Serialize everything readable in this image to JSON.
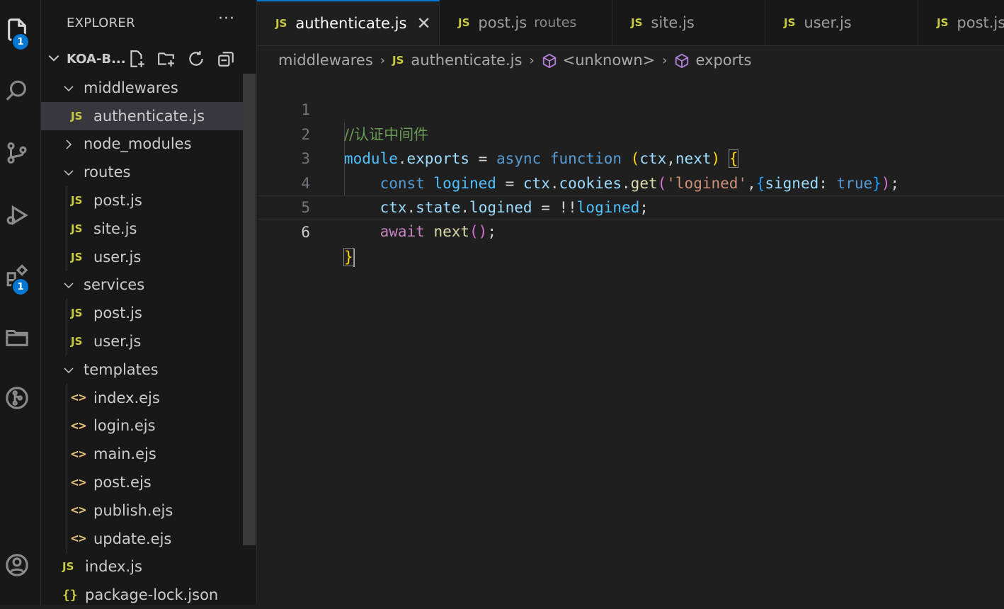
{
  "activity_bar": {
    "explorer_badge": "1",
    "extensions_badge": "1"
  },
  "sidebar": {
    "title": "EXPLORER",
    "more": "···",
    "project": "KOA-B...",
    "tree": [
      {
        "label": "middlewares",
        "kind": "folder",
        "open": true,
        "depth": 1
      },
      {
        "label": "authenticate.js",
        "kind": "js",
        "depth": 2,
        "selected": true
      },
      {
        "label": "node_modules",
        "kind": "folder",
        "open": false,
        "depth": 1
      },
      {
        "label": "routes",
        "kind": "folder",
        "open": true,
        "depth": 1
      },
      {
        "label": "post.js",
        "kind": "js",
        "depth": 2
      },
      {
        "label": "site.js",
        "kind": "js",
        "depth": 2
      },
      {
        "label": "user.js",
        "kind": "js",
        "depth": 2
      },
      {
        "label": "services",
        "kind": "folder",
        "open": true,
        "depth": 1
      },
      {
        "label": "post.js",
        "kind": "js",
        "depth": 2
      },
      {
        "label": "user.js",
        "kind": "js",
        "depth": 2
      },
      {
        "label": "templates",
        "kind": "folder",
        "open": true,
        "depth": 1
      },
      {
        "label": "index.ejs",
        "kind": "ejs",
        "depth": 2
      },
      {
        "label": "login.ejs",
        "kind": "ejs",
        "depth": 2
      },
      {
        "label": "main.ejs",
        "kind": "ejs",
        "depth": 2
      },
      {
        "label": "post.ejs",
        "kind": "ejs",
        "depth": 2
      },
      {
        "label": "publish.ejs",
        "kind": "ejs",
        "depth": 2
      },
      {
        "label": "update.ejs",
        "kind": "ejs",
        "depth": 2
      },
      {
        "label": "index.js",
        "kind": "js",
        "depth": 1
      },
      {
        "label": "package-lock.json",
        "kind": "json",
        "depth": 1
      }
    ]
  },
  "tabs": [
    {
      "label": "authenticate.js",
      "icon": "JS",
      "active": true,
      "close": "✕"
    },
    {
      "label": "post.js",
      "icon": "JS",
      "desc": "routes"
    },
    {
      "label": "site.js",
      "icon": "JS"
    },
    {
      "label": "user.js",
      "icon": "JS"
    },
    {
      "label": "post.js",
      "icon": "JS"
    }
  ],
  "breadcrumb": {
    "folder": "middlewares",
    "file_icon": "JS",
    "file": "authenticate.js",
    "symbol1": "<unknown>",
    "symbol2": "exports"
  },
  "editor": {
    "line_numbers": [
      "1",
      "2",
      "3",
      "4",
      "5",
      "6"
    ],
    "current_line": 6,
    "colors": {
      "background": "#1f1f1f",
      "comment": "#6a9955",
      "keyword": "#569cd6",
      "string": "#ce9178",
      "accent": "#0078d4"
    }
  }
}
